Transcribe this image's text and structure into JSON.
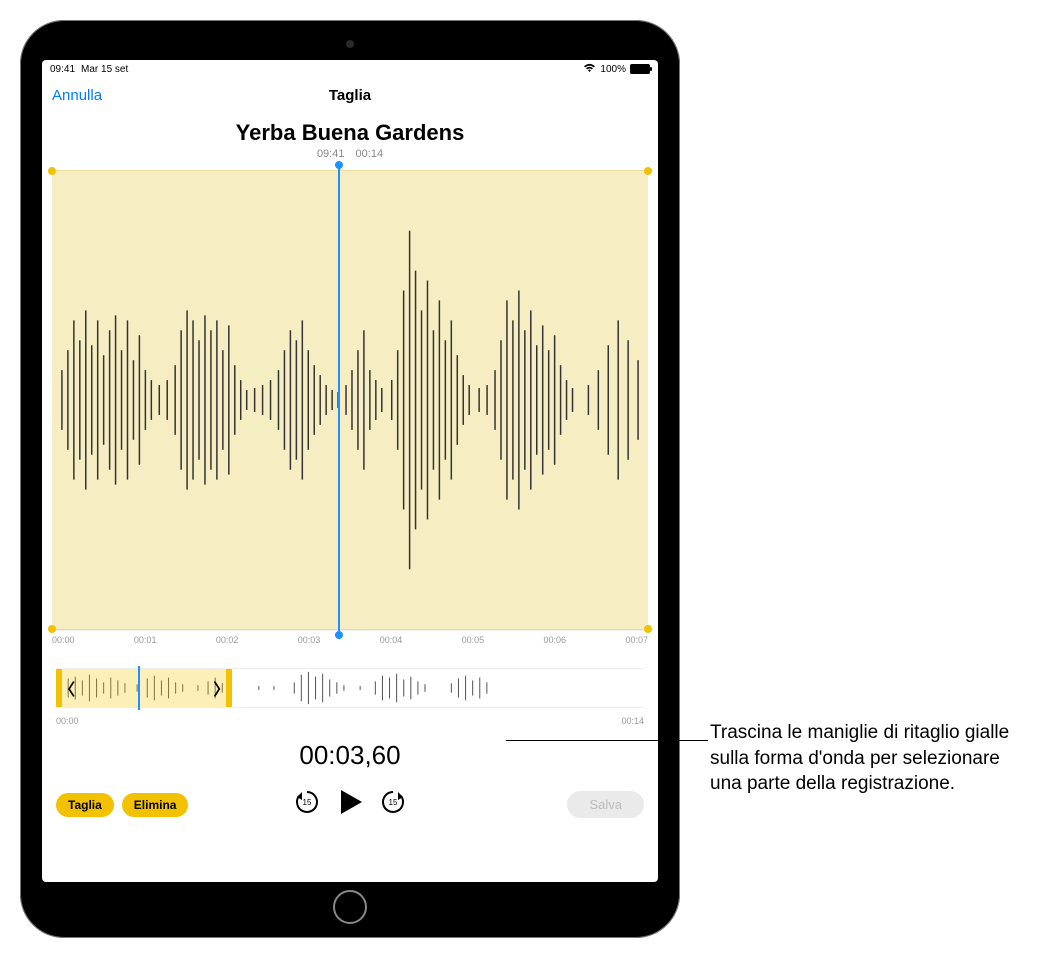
{
  "status": {
    "time": "09:41",
    "date": "Mar 15 set",
    "battery_text": "100%"
  },
  "nav": {
    "cancel": "Annulla",
    "title": "Taglia"
  },
  "recording": {
    "title": "Yerba Buena Gardens",
    "clock": "09:41",
    "duration": "00:14"
  },
  "ruler": {
    "ticks": [
      "00:00",
      "00:01",
      "00:02",
      "00:03",
      "00:04",
      "00:05",
      "00:06",
      "00:07"
    ]
  },
  "overview": {
    "start": "00:00",
    "end": "00:14"
  },
  "playback": {
    "timer": "00:03,60",
    "playhead_percent_main": 48,
    "selection_overview_percent": 30,
    "playhead_overview_percent": 14
  },
  "actions": {
    "trim": "Taglia",
    "delete": "Elimina",
    "save": "Salva",
    "skip_seconds": "15"
  },
  "callout": {
    "text": "Trascina le maniglie di ritaglio gialle sulla forma d'onda per selezionare una parte della registrazione."
  }
}
